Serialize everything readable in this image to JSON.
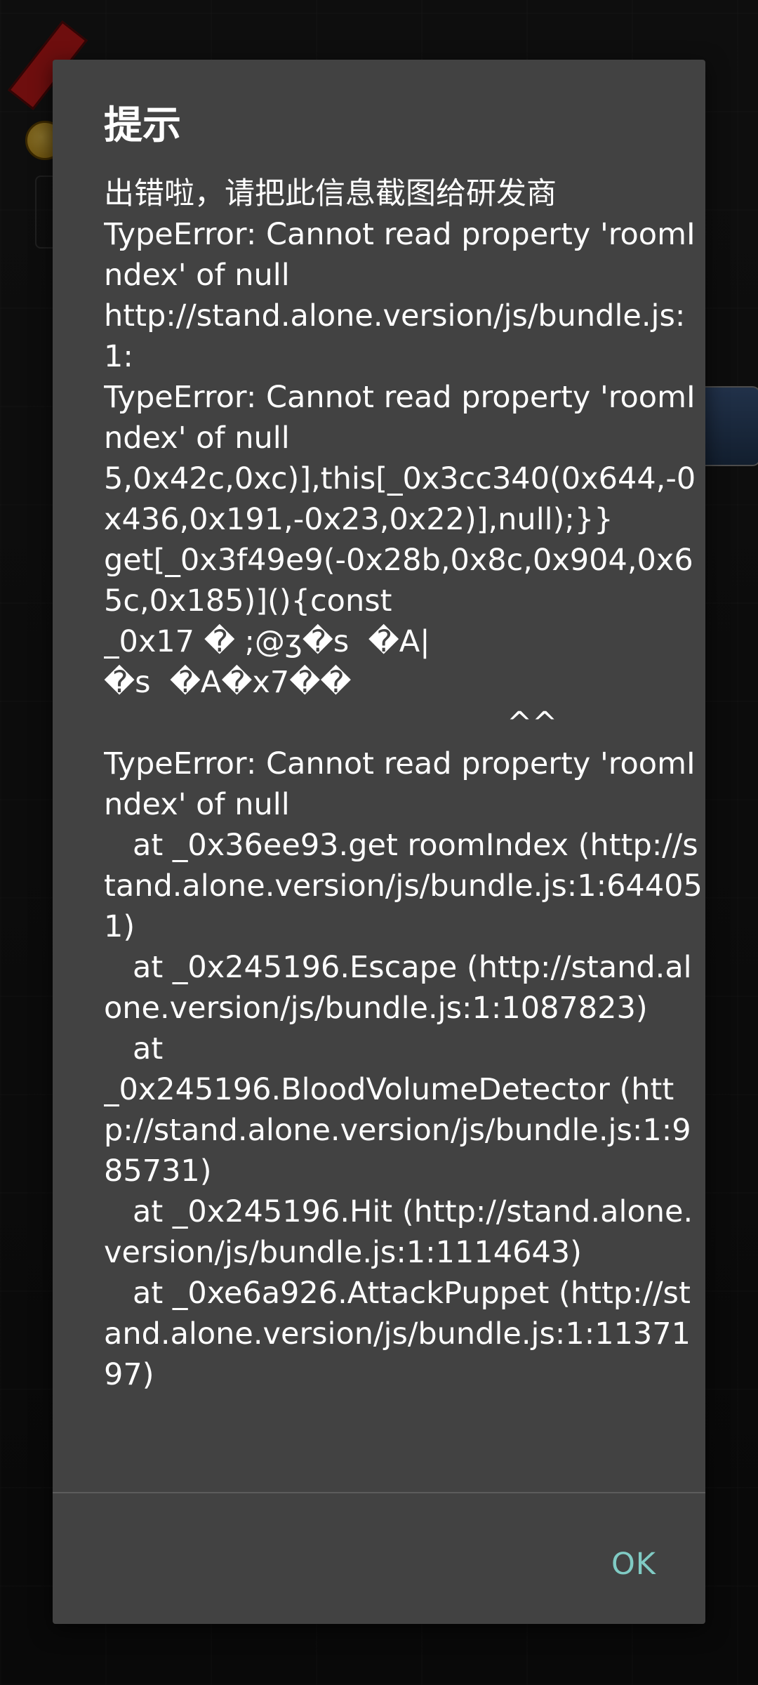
{
  "dialog": {
    "title": "提示",
    "message": "出错啦，请把此信息截图给研发商\nTypeError: Cannot read property 'roomIndex' of null\nhttp://stand.alone.version/js/bundle.js:1:\nTypeError: Cannot read property 'roomIndex' of null\n5,0x42c,0xc)],this[_0x3cc340(0x644,-0x436,0x191,-0x23,0x22)],null);}}\nget[_0x3f49e9(-0x28b,0x8c,0x904,0x65c,0x185)](){const\n_0x17 � ;@ʒ�s  �A|\n�s  �A�x7��\n                                          ^^\nTypeError: Cannot read property 'roomIndex' of null\n   at _0x36ee93.get roomIndex (http://stand.alone.version/js/bundle.js:1:644051)\n   at _0x245196.Escape (http://stand.alone.version/js/bundle.js:1:1087823)\n   at\n_0x245196.BloodVolumeDetector (http://stand.alone.version/js/bundle.js:1:985731)\n   at _0x245196.Hit (http://stand.alone.version/js/bundle.js:1:1114643)\n   at _0xe6a926.AttackPuppet (http://stand.alone.version/js/bundle.js:1:1137197)",
    "ok_label": "OK"
  },
  "colors": {
    "dialog_bg": "#424242",
    "accent": "#80cbc4"
  }
}
